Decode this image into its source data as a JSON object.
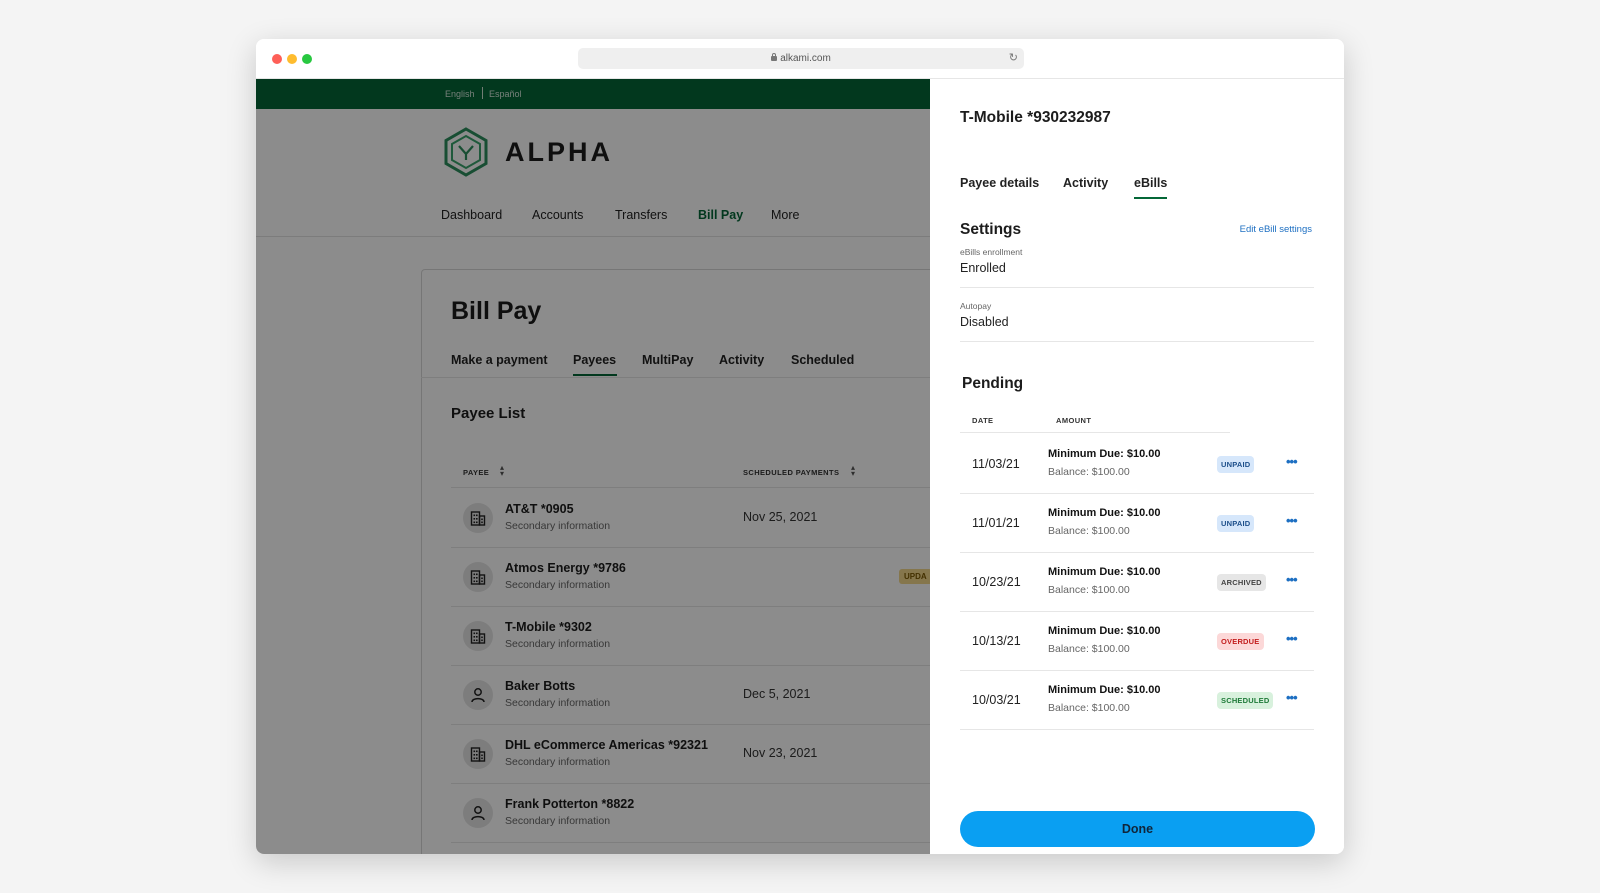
{
  "browser": {
    "url": "alkami.com"
  },
  "app": {
    "languages": [
      "English",
      "Español"
    ],
    "brand": "ALPHA",
    "nav": [
      "Dashboard",
      "Accounts",
      "Transfers",
      "Bill Pay",
      "More"
    ],
    "page_title": "Bill Pay",
    "subtabs": [
      "Make a payment",
      "Payees",
      "MultiPay",
      "Activity",
      "Scheduled"
    ],
    "payee_list_title": "Payee List",
    "columns": {
      "payee": "PAYEE",
      "scheduled": "SCHEDULED PAYMENTS"
    },
    "payees": [
      {
        "name": "AT&T *0905",
        "secondary": "Secondary information",
        "date": "Nov 25, 2021",
        "icon": "building-icon",
        "tag": ""
      },
      {
        "name": "Atmos Energy *9786",
        "secondary": "Secondary information",
        "date": "",
        "icon": "building-icon",
        "tag": "UPDA"
      },
      {
        "name": "T-Mobile *9302",
        "secondary": "Secondary information",
        "date": "",
        "icon": "building-icon",
        "tag": ""
      },
      {
        "name": "Baker Botts",
        "secondary": "Secondary information",
        "date": "Dec 5, 2021",
        "icon": "person-icon",
        "tag": ""
      },
      {
        "name": "DHL eCommerce Americas *92321",
        "secondary": "Secondary information",
        "date": "Nov 23, 2021",
        "icon": "building-icon",
        "tag": ""
      },
      {
        "name": "Frank Potterton *8822",
        "secondary": "Secondary information",
        "date": "",
        "icon": "person-icon",
        "tag": ""
      }
    ]
  },
  "panel": {
    "title": "T-Mobile *930232987",
    "tabs": [
      "Payee details",
      "Activity",
      "eBills"
    ],
    "settings_title": "Settings",
    "edit_link": "Edit eBill settings",
    "enrollment_label": "eBills enrollment",
    "enrollment_value": "Enrolled",
    "autopay_label": "Autopay",
    "autopay_value": "Disabled",
    "pending_title": "Pending",
    "col_date": "DATE",
    "col_amount": "AMOUNT",
    "ebills": [
      {
        "date": "11/03/21",
        "min": "Minimum Due: $10.00",
        "balance": "Balance: $100.00",
        "status": "UNPAID"
      },
      {
        "date": "11/01/21",
        "min": "Minimum Due: $10.00",
        "balance": "Balance: $100.00",
        "status": "UNPAID"
      },
      {
        "date": "10/23/21",
        "min": "Minimum Due: $10.00",
        "balance": "Balance: $100.00",
        "status": "ARCHIVED"
      },
      {
        "date": "10/13/21",
        "min": "Minimum Due: $10.00",
        "balance": "Balance: $100.00",
        "status": "OVERDUE"
      },
      {
        "date": "10/03/21",
        "min": "Minimum Due: $10.00",
        "balance": "Balance: $100.00",
        "status": "SCHEDULED"
      }
    ],
    "done_label": "Done"
  }
}
